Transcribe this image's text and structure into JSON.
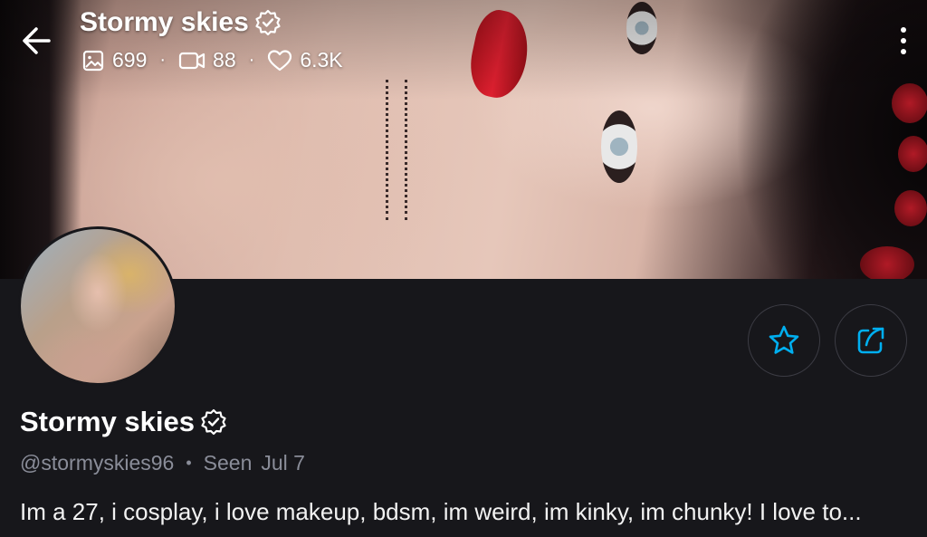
{
  "header": {
    "title": "Stormy skies",
    "stats": {
      "photos": "699",
      "videos": "88",
      "likes": "6.3K"
    }
  },
  "profile": {
    "name": "Stormy skies",
    "handle": "@stormyskies96",
    "seen_label": "Seen",
    "seen_date": "Jul 7",
    "bio": "Im a 27, i cosplay, i love makeup, bdsm, im weird, im kinky, im chunky! I love to..."
  },
  "icons": {
    "back": "arrow-left-icon",
    "verified": "verified-badge-icon",
    "photos": "image-icon",
    "videos": "video-camera-icon",
    "likes": "heart-icon",
    "more": "more-vertical-icon",
    "favorite": "star-icon",
    "share": "share-icon"
  },
  "colors": {
    "background": "#17171b",
    "accent": "#00aff0",
    "muted_text": "#8a8d99"
  }
}
